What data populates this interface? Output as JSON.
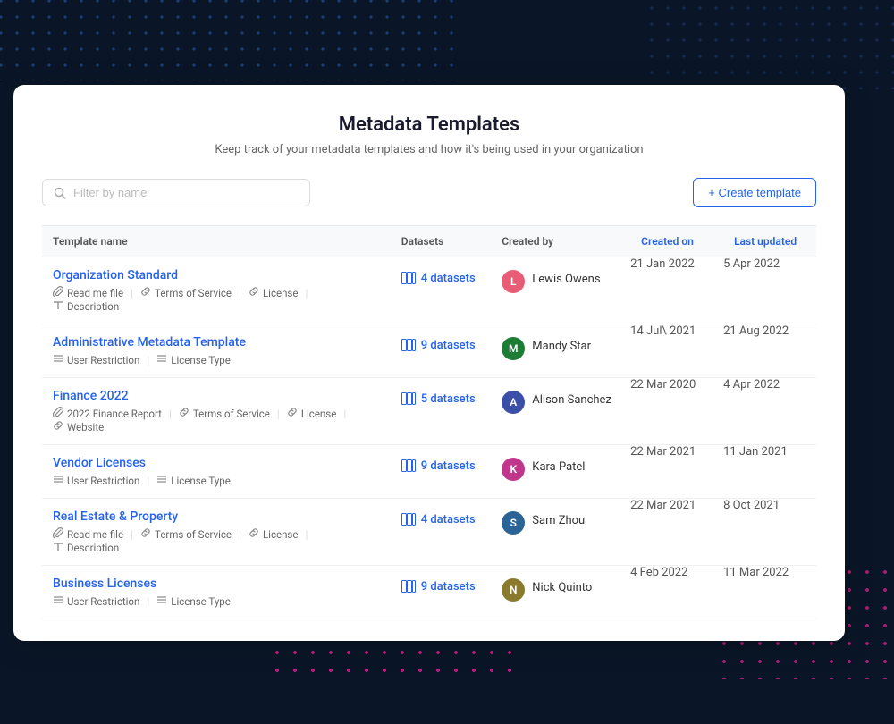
{
  "page": {
    "title": "Metadata Templates",
    "subtitle": "Keep track of your metadata templates and how it's being used in your organization"
  },
  "search": {
    "placeholder": "Filter by name"
  },
  "create_button": "+ Create template",
  "table": {
    "headers": [
      {
        "key": "template_name",
        "label": "Template name"
      },
      {
        "key": "datasets",
        "label": "Datasets"
      },
      {
        "key": "created_by",
        "label": "Created by"
      },
      {
        "key": "created_on",
        "label": "Created on"
      },
      {
        "key": "last_updated",
        "label": "Last updated"
      }
    ],
    "rows": [
      {
        "id": 1,
        "name": "Organization Standard",
        "tags": [
          {
            "icon": "📎",
            "label": "Read me file"
          },
          {
            "icon": "🔗",
            "label": "Terms of Service"
          },
          {
            "icon": "🔗",
            "label": "License"
          },
          {
            "icon": "T",
            "label": "Description"
          }
        ],
        "datasets_count": "4 datasets",
        "author": "Lewis Owens",
        "author_initial": "L",
        "author_color": "#e85d75",
        "created_on": "21 Jan 2022",
        "last_updated": "5 Apr 2022"
      },
      {
        "id": 2,
        "name": "Administrative Metadata Template",
        "tags": [
          {
            "icon": "≡",
            "label": "User Restriction"
          },
          {
            "icon": "≡",
            "label": "License Type"
          }
        ],
        "datasets_count": "9 datasets",
        "author": "Mandy Star",
        "author_initial": "M",
        "author_color": "#1e7d34",
        "created_on": "14 Jul\\ 2021",
        "last_updated": "21 Aug 2022"
      },
      {
        "id": 3,
        "name": "Finance 2022",
        "tags": [
          {
            "icon": "📎",
            "label": "2022 Finance Report"
          },
          {
            "icon": "🔗",
            "label": "Terms of Service"
          },
          {
            "icon": "🔗",
            "label": "License"
          },
          {
            "icon": "🔗",
            "label": "Website"
          }
        ],
        "datasets_count": "5 datasets",
        "author": "Alison Sanchez",
        "author_initial": "A",
        "author_color": "#3b4fa8",
        "created_on": "22 Mar 2020",
        "last_updated": "4 Apr 2022"
      },
      {
        "id": 4,
        "name": "Vendor Licenses",
        "tags": [
          {
            "icon": "≡",
            "label": "User Restriction"
          },
          {
            "icon": "≡",
            "label": "License Type"
          }
        ],
        "datasets_count": "9 datasets",
        "author": "Kara Patel",
        "author_initial": "K",
        "author_color": "#c0368a",
        "created_on": "22 Mar 2021",
        "last_updated": "11 Jan 2021"
      },
      {
        "id": 5,
        "name": "Real Estate & Property",
        "tags": [
          {
            "icon": "📎",
            "label": "Read me file"
          },
          {
            "icon": "🔗",
            "label": "Terms of Service"
          },
          {
            "icon": "🔗",
            "label": "License"
          },
          {
            "icon": "T",
            "label": "Description"
          }
        ],
        "datasets_count": "4 datasets",
        "author": "Sam Zhou",
        "author_initial": "S",
        "author_color": "#2a6496",
        "created_on": "22 Mar 2021",
        "last_updated": "8 Oct 2021"
      },
      {
        "id": 6,
        "name": "Business Licenses",
        "tags": [
          {
            "icon": "≡",
            "label": "User Restriction"
          },
          {
            "icon": "≡",
            "label": "License Type"
          }
        ],
        "datasets_count": "9 datasets",
        "author": "Nick Quinto",
        "author_initial": "N",
        "author_color": "#8a7a2e",
        "created_on": "4 Feb 2022",
        "last_updated": "11 Mar 2022"
      }
    ]
  }
}
